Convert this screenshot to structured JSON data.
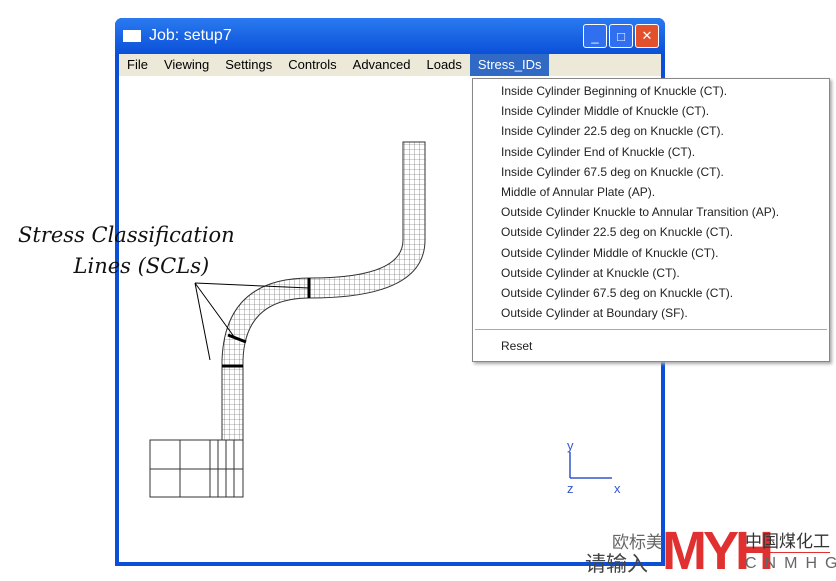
{
  "window": {
    "title": "Job: setup7",
    "minimize": "_",
    "maximize": "□",
    "close": "✕"
  },
  "menu": [
    "File",
    "Viewing",
    "Settings",
    "Controls",
    "Advanced",
    "Loads",
    "Stress_IDs"
  ],
  "dropdown": {
    "items": [
      "Inside Cylinder Beginning of Knuckle (CT).",
      "Inside Cylinder Middle of Knuckle (CT).",
      "Inside Cylinder 22.5 deg on Knuckle (CT).",
      "Inside Cylinder End of Knuckle (CT).",
      "Inside Cylinder 67.5 deg on Knuckle (CT).",
      "Middle of Annular Plate (AP).",
      "Outside Cylinder Knuckle to Annular Transition (AP).",
      "Outside Cylinder 22.5 deg on Knuckle (CT).",
      "Outside Cylinder Middle of Knuckle (CT).",
      "Outside Cylinder at Knuckle (CT).",
      "Outside Cylinder 67.5 deg on Knuckle (CT).",
      "Outside Cylinder at Boundary  (SF)."
    ],
    "reset": "Reset"
  },
  "annotation": {
    "line1": "Stress Classification",
    "line2": "Lines (SCLs)"
  },
  "axes": {
    "y": "y",
    "z": "z",
    "x": "x"
  },
  "watermark": {
    "text1": "欧标美",
    "text2": "请输入",
    "logo": "MYH",
    "brand_cn": "中国煤化工",
    "brand_en": "CNMHG"
  }
}
